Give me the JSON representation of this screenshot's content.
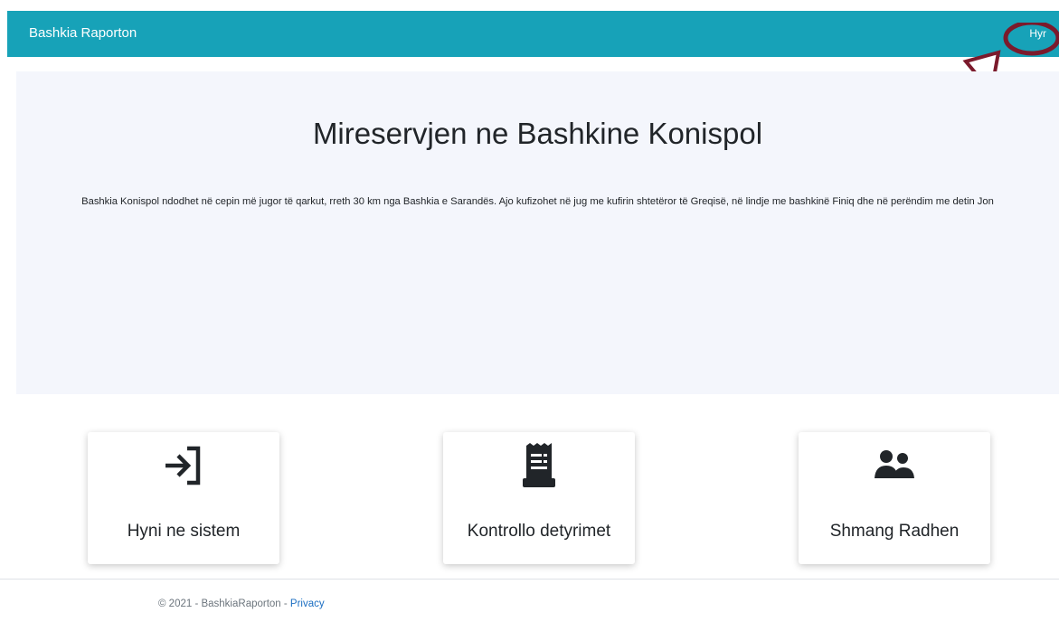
{
  "navbar": {
    "brand": "Bashkia Raporton",
    "login_label": "Hyr",
    "bg_color": "#17a2b8"
  },
  "jumbotron": {
    "title": "Mireservjen ne Bashkine Konispol",
    "description": "Bashkia Konispol ndodhet në cepin më jugor të qarkut, rreth 30 km nga Bashkia e Sarandës. Ajo kufizohet në jug me kufirin shtetëror të Greqisë, në lindje me bashkinë Finiq dhe në perëndim me detin Jon"
  },
  "cards": [
    {
      "label": "Hyni ne sistem",
      "icon": "sign-in-icon"
    },
    {
      "label": "Kontrollo detyrimet",
      "icon": "receipt-icon"
    },
    {
      "label": "Shmang Radhen",
      "icon": "user-group-icon"
    }
  ],
  "annotation": {
    "color": "#7b1a2c",
    "shape": "arrow-and-circle"
  },
  "footer": {
    "copyright": "© 2021 - BashkiaRaporton - ",
    "privacy_label": "Privacy"
  }
}
